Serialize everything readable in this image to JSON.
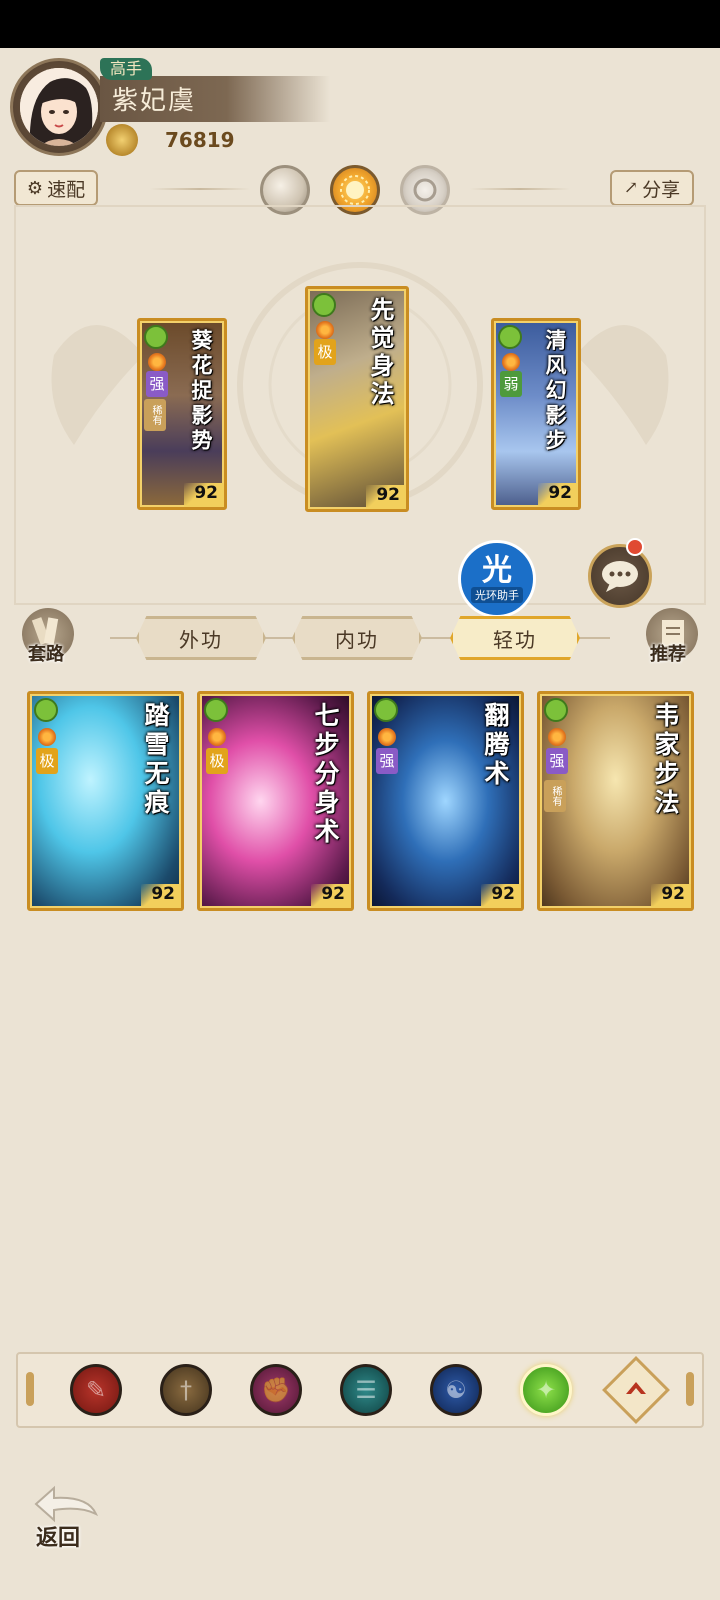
{
  "profile": {
    "rank": "高手",
    "name": "紫妃虞",
    "power": "76819"
  },
  "toolbar": {
    "quick_match": "速配",
    "share": "分享"
  },
  "equipped": [
    {
      "title": "葵花捉影势",
      "grade": "强",
      "rare": "稀有",
      "level": "92"
    },
    {
      "title": "先觉身法",
      "grade": "极",
      "level": "92"
    },
    {
      "title": "清风幻影步",
      "grade": "弱",
      "level": "92"
    }
  ],
  "watermark": "光环助手",
  "tabs": {
    "set": "套路",
    "outer": "外功",
    "inner": "内功",
    "light": "轻功",
    "recommend": "推荐",
    "selected": "轻功"
  },
  "skills": [
    {
      "title": "踏雪无痕",
      "grade": "极",
      "level": "92"
    },
    {
      "title": "七步分身术",
      "grade": "极",
      "level": "92"
    },
    {
      "title": "翻腾术",
      "grade": "强",
      "level": "92"
    },
    {
      "title": "韦家步法",
      "grade": "强",
      "rare": "稀有",
      "level": "92"
    }
  ],
  "schools": [
    "blade-school-icon",
    "sword-school-icon",
    "fist-school-icon",
    "fan-school-icon",
    "taiji-school-icon",
    "hidden-weapon-school-icon",
    "up-arrow-icon"
  ],
  "back": "返回",
  "colors": {
    "background": "#ebe3d4",
    "card_border": "#c98d22",
    "selected_tab": "#f7ecc8",
    "grade_extreme": "#e2a31b",
    "grade_strong": "#8a5bc6",
    "grade_weak": "#4e9a3c"
  }
}
